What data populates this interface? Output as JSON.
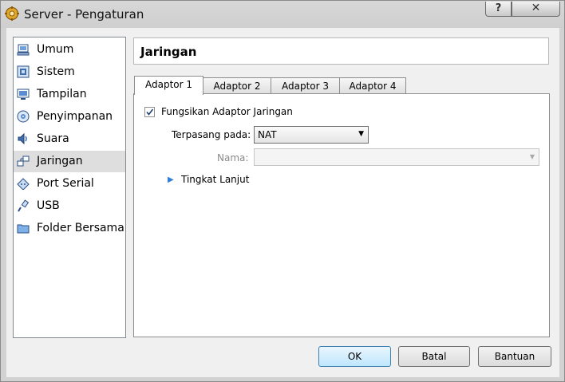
{
  "window": {
    "title": "Server - Pengaturan"
  },
  "sidebar": {
    "items": [
      {
        "label": "Umum",
        "icon": "general-icon"
      },
      {
        "label": "Sistem",
        "icon": "system-icon"
      },
      {
        "label": "Tampilan",
        "icon": "display-icon"
      },
      {
        "label": "Penyimpanan",
        "icon": "storage-icon"
      },
      {
        "label": "Suara",
        "icon": "audio-icon"
      },
      {
        "label": "Jaringan",
        "icon": "network-icon",
        "selected": true
      },
      {
        "label": "Port Serial",
        "icon": "serial-port-icon"
      },
      {
        "label": "USB",
        "icon": "usb-icon"
      },
      {
        "label": "Folder Bersama",
        "icon": "shared-folder-icon"
      }
    ]
  },
  "page": {
    "title": "Jaringan"
  },
  "tabs": [
    {
      "label": "Adaptor 1",
      "active": true
    },
    {
      "label": "Adaptor 2"
    },
    {
      "label": "Adaptor 3"
    },
    {
      "label": "Adaptor 4"
    }
  ],
  "adapter": {
    "enable_label": "Fungsikan Adaptor Jaringan",
    "enabled": true,
    "attached_label": "Terpasang pada:",
    "attached_value": "NAT",
    "name_label": "Nama:",
    "name_value": "",
    "advanced_label": "Tingkat Lanjut"
  },
  "buttons": {
    "ok": "OK",
    "cancel": "Batal",
    "help": "Bantuan"
  },
  "colors": {
    "accent": "#2f7fd8",
    "selection": "#dedede"
  }
}
